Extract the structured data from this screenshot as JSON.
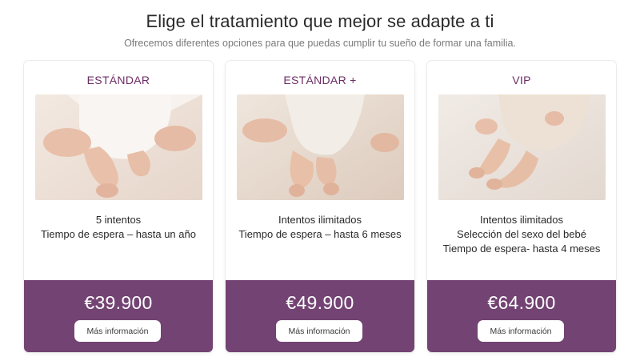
{
  "heading": {
    "title": "Elige el tratamiento que mejor se adapte a ti",
    "subtitle": "Ofrecemos diferentes opciones para que puedas cumplir tu sueño de formar una familia."
  },
  "colors": {
    "accent": "#6c2c66",
    "price_band": "#734373"
  },
  "plans": [
    {
      "name": "ESTÁNDAR",
      "features": [
        "5 intentos",
        "Tiempo de espera – hasta un año"
      ],
      "price": "€39.900",
      "button": "Más información",
      "image": "baby-photo"
    },
    {
      "name": "ESTÁNDAR +",
      "features": [
        "Intentos ilimitados",
        "Tiempo de espera – hasta 6 meses"
      ],
      "price": "€49.900",
      "button": "Más información",
      "image": "baby-photo"
    },
    {
      "name": "VIP",
      "features": [
        "Intentos ilimitados",
        "Selección del sexo del bebé",
        "Tiempo de espera- hasta 4 meses"
      ],
      "price": "€64.900",
      "button": "Más información",
      "image": "baby-photo"
    }
  ]
}
